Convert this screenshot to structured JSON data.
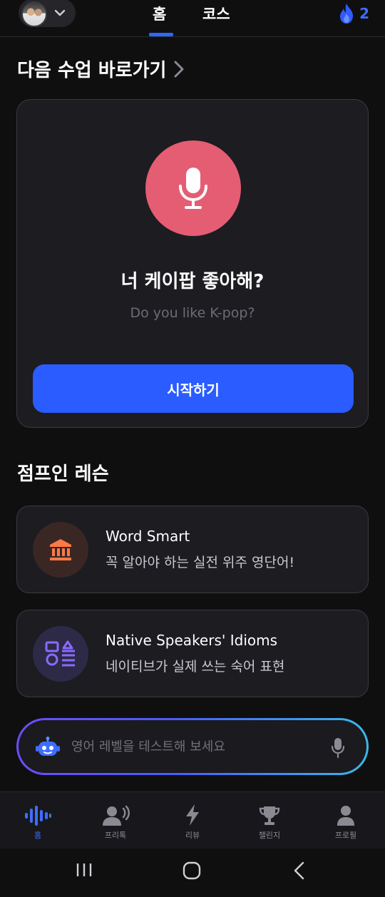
{
  "header": {
    "tabs": [
      {
        "label": "홈",
        "active": true
      },
      {
        "label": "코스",
        "active": false
      }
    ],
    "streak_count": "2",
    "accent_color": "#2f67ff"
  },
  "next_lesson": {
    "section_title": "다음 수업 바로가기",
    "phrase_ko": "너 케이팝 좋아해?",
    "phrase_en": "Do you like K-pop?",
    "start_label": "시작하기",
    "mic_color": "#e45d72"
  },
  "jump_in": {
    "section_title": "점프인 레슨",
    "lessons": [
      {
        "title": "Word Smart",
        "subtitle": "꼭 알아야 하는 실전 위주 영단어!",
        "icon": "bank-icon"
      },
      {
        "title": "Native Speakers' Idioms",
        "subtitle": "네이티브가 실제 쓰는 숙어 표현",
        "icon": "idiom-icon"
      }
    ]
  },
  "ai_bar": {
    "placeholder": "영어 레벨을 테스트해 보세요"
  },
  "bottom_nav": {
    "items": [
      {
        "label": "홈",
        "icon": "sound-wave-icon",
        "active": true
      },
      {
        "label": "프리톡",
        "icon": "speaking-person-icon",
        "active": false
      },
      {
        "label": "리뷰",
        "icon": "lightning-icon",
        "active": false
      },
      {
        "label": "챌린지",
        "icon": "trophy-icon",
        "active": false
      },
      {
        "label": "프로필",
        "icon": "person-icon",
        "active": false
      }
    ]
  }
}
